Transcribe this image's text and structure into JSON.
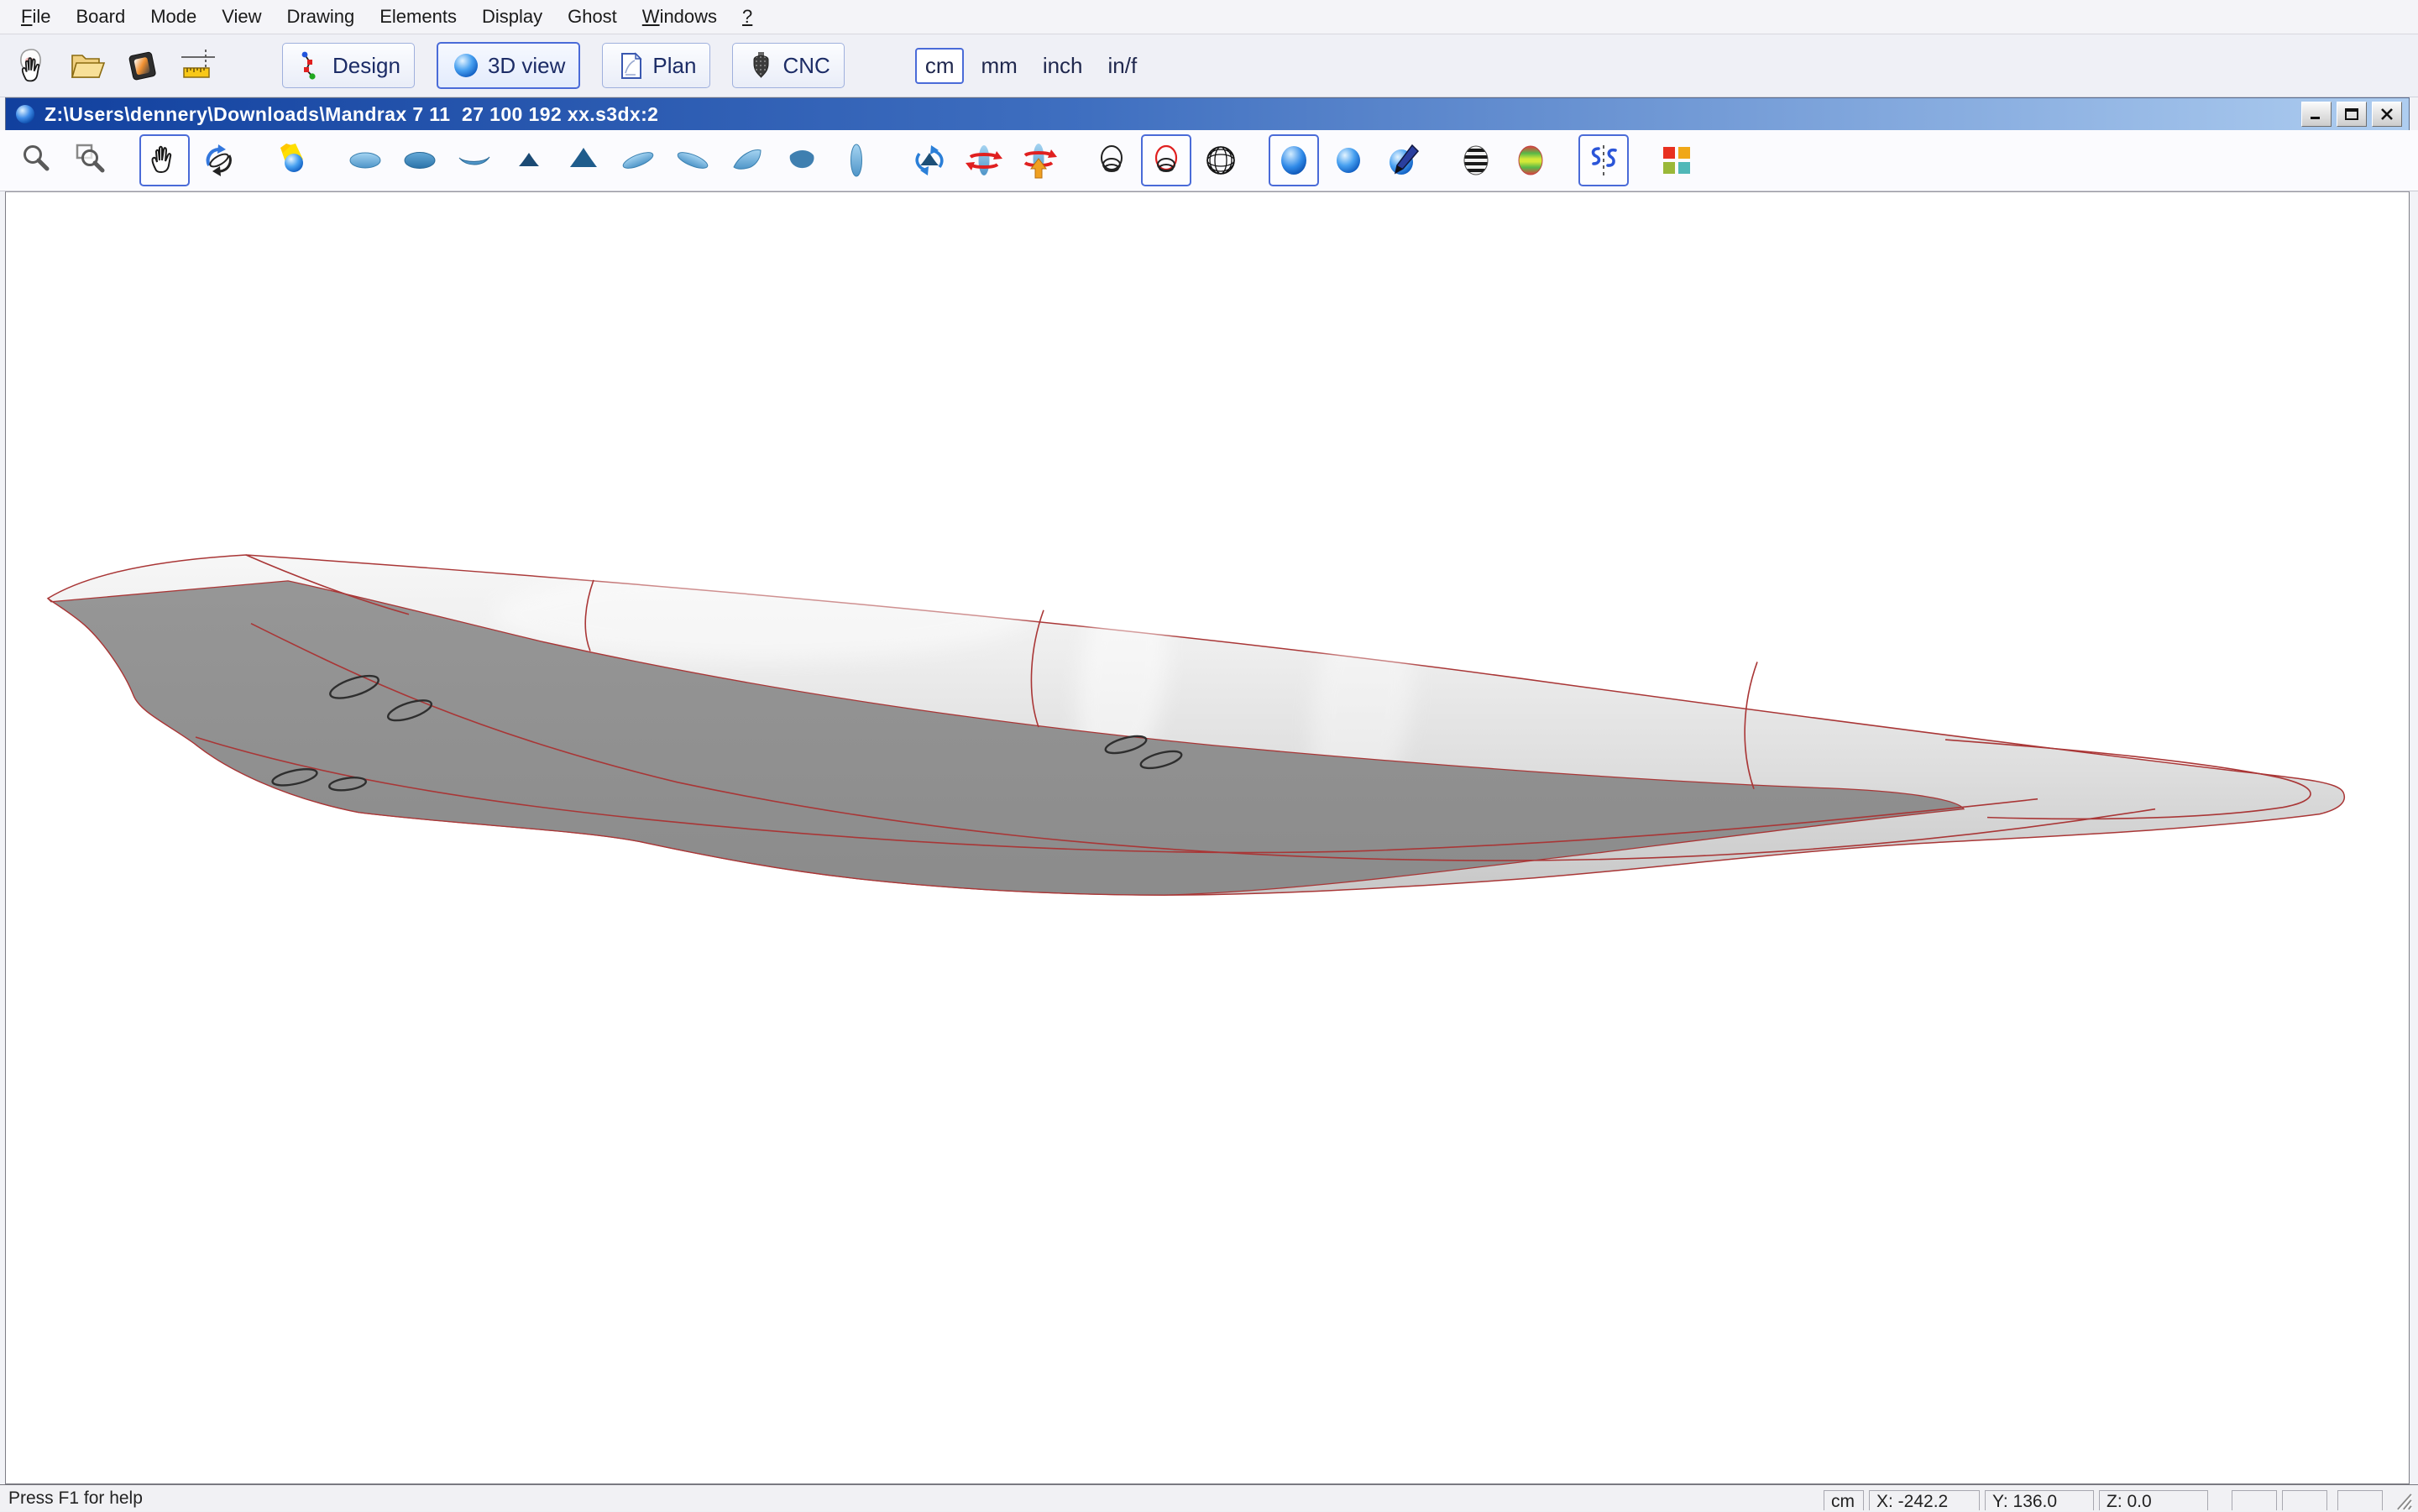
{
  "menu": {
    "items": [
      {
        "label": "File",
        "u": "F"
      },
      {
        "label": "Board",
        "u": ""
      },
      {
        "label": "Mode",
        "u": ""
      },
      {
        "label": "View",
        "u": ""
      },
      {
        "label": "Drawing",
        "u": ""
      },
      {
        "label": "Elements",
        "u": ""
      },
      {
        "label": "Display",
        "u": ""
      },
      {
        "label": "Ghost",
        "u": ""
      },
      {
        "label": "Windows",
        "u": "W"
      },
      {
        "label": "?",
        "u": "?"
      }
    ]
  },
  "toolbar_main": {
    "icons": [
      {
        "name": "new-board-hand-icon"
      },
      {
        "name": "open-folder-icon"
      },
      {
        "name": "save-board-icon"
      },
      {
        "name": "measurements-guidelines-icon"
      }
    ],
    "buttons": [
      {
        "label": "Design",
        "icon": "design-points-icon",
        "selected": false
      },
      {
        "label": "3D view",
        "icon": "sphere-3d-icon",
        "selected": true
      },
      {
        "label": "Plan",
        "icon": "plan-sheet-icon",
        "selected": false
      },
      {
        "label": "CNC",
        "icon": "cnc-bit-icon",
        "selected": false
      }
    ],
    "units": [
      {
        "label": "cm",
        "selected": true
      },
      {
        "label": "mm",
        "selected": false
      },
      {
        "label": "inch",
        "selected": false
      },
      {
        "label": "in/f",
        "selected": false
      }
    ]
  },
  "document_window": {
    "title": "Z:\\Users\\dennery\\Downloads\\Mandrax 7 11  27 100 192 xx.s3dx:2",
    "controls": [
      "minimize",
      "maximize",
      "close"
    ]
  },
  "toolbar_view": {
    "icons": [
      {
        "name": "zoom-icon",
        "selected": false
      },
      {
        "name": "zoom-window-icon",
        "selected": false
      },
      {
        "name": "pan-hand-icon",
        "selected": true
      },
      {
        "name": "rotate-3d-icon",
        "selected": false
      },
      {
        "name": "lighting-icon",
        "selected": false
      },
      {
        "name": "view-deck-icon",
        "selected": false
      },
      {
        "name": "view-bottom-icon",
        "selected": false
      },
      {
        "name": "view-rail-icon",
        "selected": false
      },
      {
        "name": "view-tail-small-icon",
        "selected": false
      },
      {
        "name": "view-tail-big-icon",
        "selected": false
      },
      {
        "name": "view-perspective-left-icon",
        "selected": false
      },
      {
        "name": "view-perspective-right-icon",
        "selected": false
      },
      {
        "name": "view-nose-left-icon",
        "selected": false
      },
      {
        "name": "view-nose-right-icon",
        "selected": false
      },
      {
        "name": "view-plan-vertical-icon",
        "selected": false
      },
      {
        "name": "rotate-vertical-icon",
        "selected": false
      },
      {
        "name": "rotate-longitudinal-icon",
        "selected": false
      },
      {
        "name": "rotate-longitudinal-up-icon",
        "selected": false
      },
      {
        "name": "wireframe-slices-icon",
        "selected": false
      },
      {
        "name": "wireframe-slices-red-icon",
        "selected": true
      },
      {
        "name": "wireframe-globe-icon",
        "selected": false
      },
      {
        "name": "render-shaded-icon",
        "selected": true
      },
      {
        "name": "render-plain-icon",
        "selected": false
      },
      {
        "name": "render-texture-pencil-icon",
        "selected": false
      },
      {
        "name": "render-zebra-icon",
        "selected": false
      },
      {
        "name": "render-curvature-rainbow-icon",
        "selected": false
      },
      {
        "name": "flex-symmetry-icon",
        "selected": true
      },
      {
        "name": "color-squares-icon",
        "selected": false
      }
    ]
  },
  "statusbar": {
    "help_text": "Press F1 for help",
    "unit": "cm",
    "x_value": "X: -242.2",
    "y_value": "Y: 136.0",
    "z_value": "Z: 0.0",
    "empty_cells": 3
  },
  "colors": {
    "accent_border": "#4a6bd8",
    "titlebar_from": "#11409e",
    "titlebar_mid": "#3f6fc0",
    "titlebar_to": "#aecdf0",
    "red_line": "#a93636",
    "board_light_top": "#f6f6f6",
    "board_light_bottom": "#c6c6c6",
    "board_dark": "#919191"
  }
}
